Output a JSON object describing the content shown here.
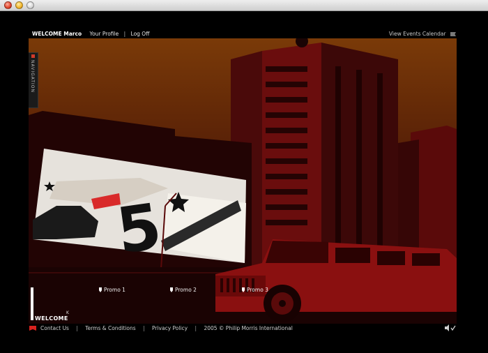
{
  "window": {
    "controls": [
      "close",
      "minimize",
      "zoom"
    ]
  },
  "topnav": {
    "welcome_prefix": "WELCOME",
    "username": "Marco",
    "profile_link": "Your Profile",
    "separator": "|",
    "logoff_link": "Log Off",
    "events_link": "View Events Calendar",
    "events_icon": "flag-icon"
  },
  "side_tab": {
    "label": "NAVIGATION"
  },
  "promos": [
    {
      "label": "Promo 1"
    },
    {
      "label": "Promo 2"
    },
    {
      "label": "Promo 3"
    }
  ],
  "welcome_logo": {
    "text": "WELCOME",
    "mark": "K"
  },
  "footer": {
    "contact": "Contact Us",
    "separator": "|",
    "terms": "Terms & Conditions",
    "privacy": "Privacy Policy",
    "copyright": "2005 © Philip Morris International",
    "sound_icon": "speaker-icon"
  },
  "colors": {
    "sky_top": "#7a3a08",
    "sky_bottom": "#2a0a04",
    "building_red": "#6a0d0d",
    "accent_red": "#d8221e"
  },
  "scene_text": {
    "billboard_numeral": "5"
  }
}
